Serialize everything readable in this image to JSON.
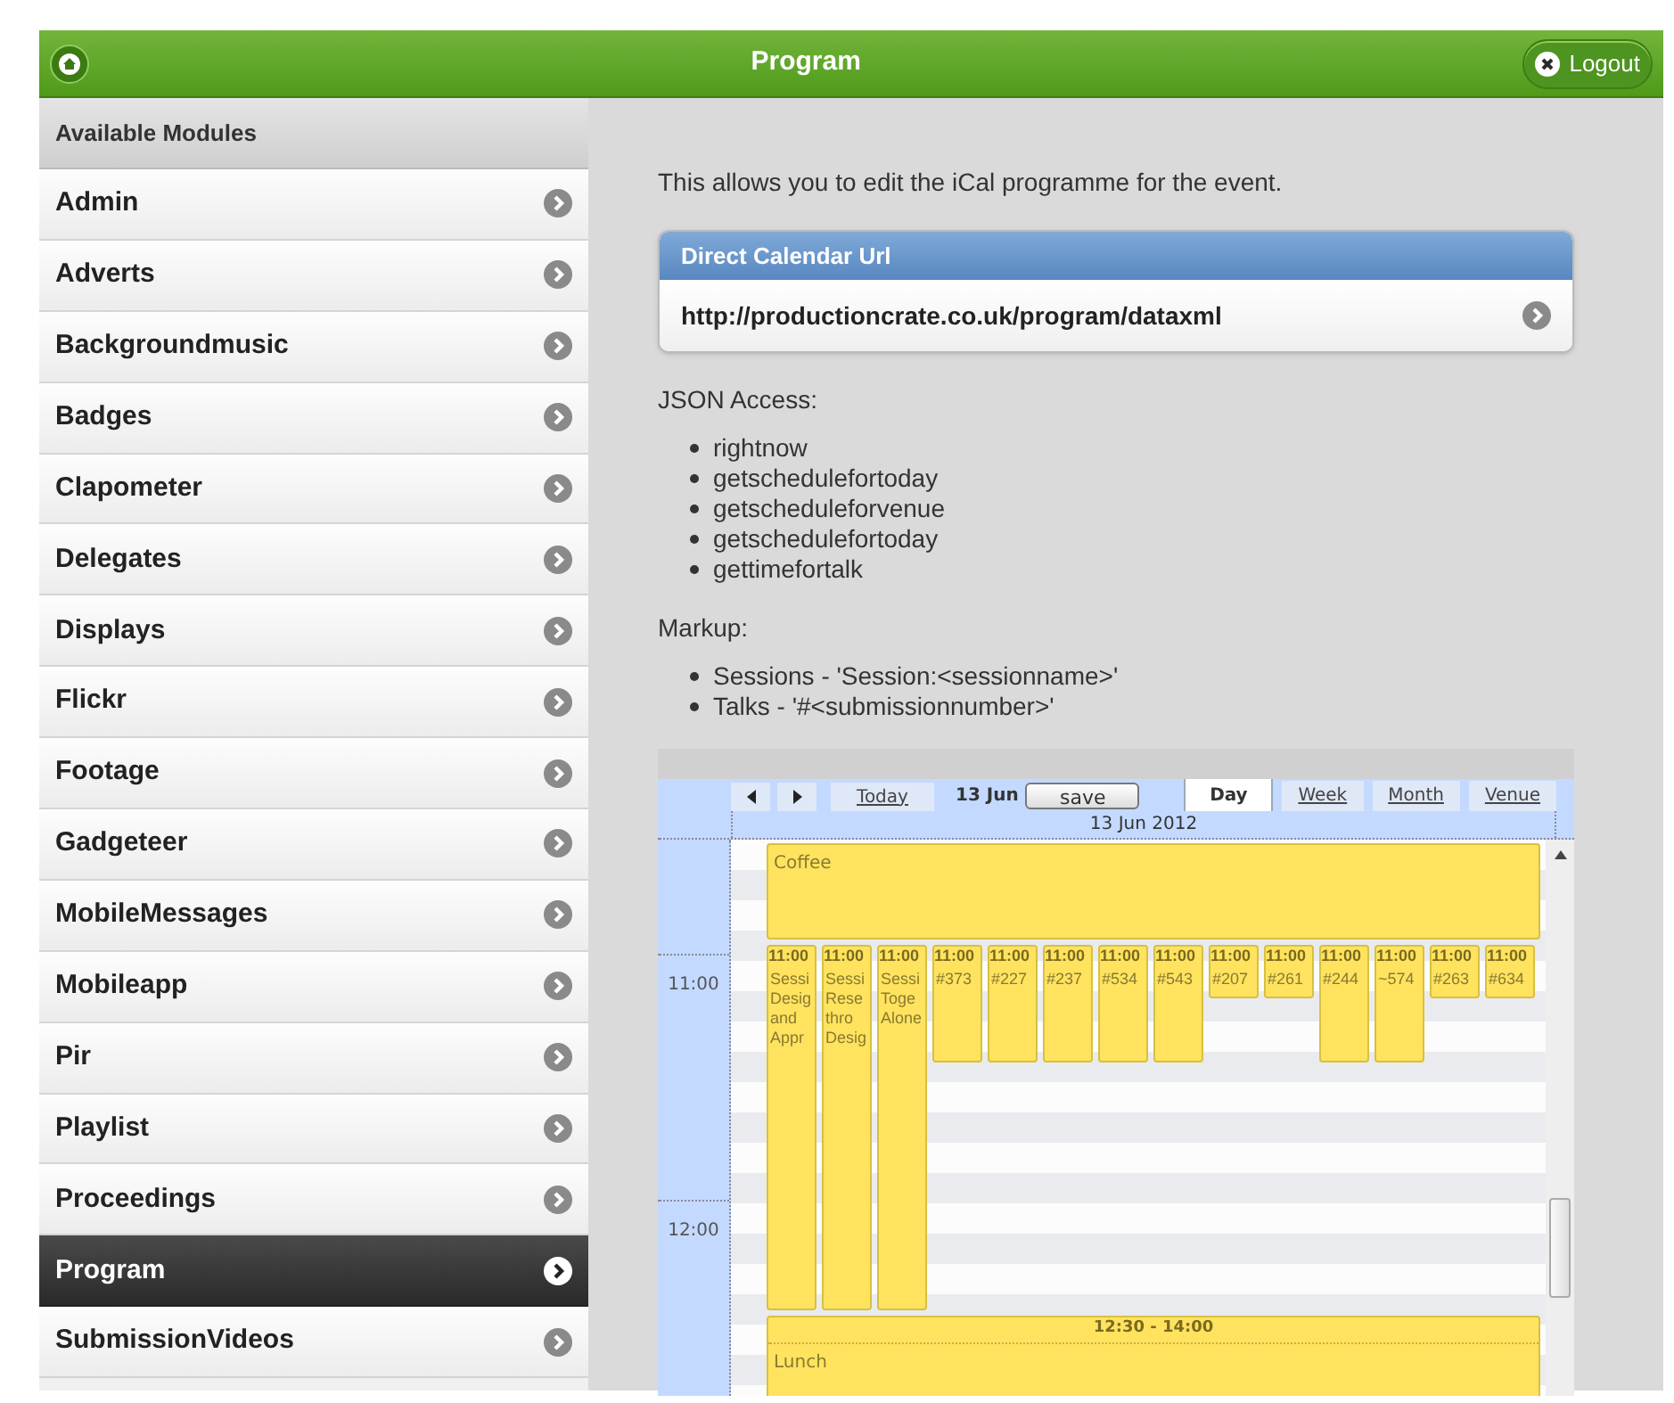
{
  "header": {
    "title": "Program",
    "logout": "Logout"
  },
  "sidebar": {
    "title": "Available Modules",
    "items": [
      {
        "label": "Admin",
        "selected": false
      },
      {
        "label": "Adverts",
        "selected": false
      },
      {
        "label": "Backgroundmusic",
        "selected": false
      },
      {
        "label": "Badges",
        "selected": false
      },
      {
        "label": "Clapometer",
        "selected": false
      },
      {
        "label": "Delegates",
        "selected": false
      },
      {
        "label": "Displays",
        "selected": false
      },
      {
        "label": "Flickr",
        "selected": false
      },
      {
        "label": "Footage",
        "selected": false
      },
      {
        "label": "Gadgeteer",
        "selected": false
      },
      {
        "label": "MobileMessages",
        "selected": false
      },
      {
        "label": "Mobileapp",
        "selected": false
      },
      {
        "label": "Pir",
        "selected": false
      },
      {
        "label": "Playlist",
        "selected": false
      },
      {
        "label": "Proceedings",
        "selected": false
      },
      {
        "label": "Program",
        "selected": true
      },
      {
        "label": "SubmissionVideos",
        "selected": false
      }
    ]
  },
  "intro": "This allows you to edit the iCal programme for the event.",
  "calendar_url": {
    "title": "Direct Calendar Url",
    "url": "http://productioncrate.co.uk/program/dataxml"
  },
  "json_access": {
    "title": "JSON Access:",
    "items": [
      "rightnow",
      "getschedulefortoday",
      "getscheduleforvenue",
      "getschedulefortoday",
      "gettimefortalk"
    ]
  },
  "markup": {
    "title": "Markup:",
    "items": [
      "Sessions - 'Session:<sessionname>'",
      "Talks - '#<submissionnumber>'"
    ]
  },
  "calendar": {
    "today": "Today",
    "date": "13 Jun",
    "save": "save",
    "date_header": "13 Jun 2012",
    "views": [
      {
        "label": "Day",
        "selected": true
      },
      {
        "label": "Week",
        "selected": false
      },
      {
        "label": "Month",
        "selected": false
      },
      {
        "label": "Venue",
        "selected": false
      }
    ],
    "hours": [
      "11:00",
      "12:00"
    ],
    "coffee": "Coffee",
    "events": [
      {
        "time": "11:00",
        "text": "Sessi Desig and Appr",
        "kind": "long"
      },
      {
        "time": "11:00",
        "text": "Sessi Rese thro Desig",
        "kind": "long"
      },
      {
        "time": "11:00",
        "text": "Sessi Toge Alone",
        "kind": "long"
      },
      {
        "time": "11:00",
        "text": "#373",
        "kind": "medium"
      },
      {
        "time": "11:00",
        "text": "#227",
        "kind": "medium"
      },
      {
        "time": "11:00",
        "text": "#237",
        "kind": "medium"
      },
      {
        "time": "11:00",
        "text": "#534",
        "kind": "medium"
      },
      {
        "time": "11:00",
        "text": "#543",
        "kind": "medium"
      },
      {
        "time": "11:00",
        "text": "#207",
        "kind": "short"
      },
      {
        "time": "11:00",
        "text": "#261",
        "kind": "short"
      },
      {
        "time": "11:00",
        "text": "#244",
        "kind": "medium"
      },
      {
        "time": "11:00",
        "text": "~574",
        "kind": "medium"
      },
      {
        "time": "11:00",
        "text": "#263",
        "kind": "short"
      },
      {
        "time": "11:00",
        "text": "#634",
        "kind": "short"
      }
    ],
    "lunch": {
      "time": "12:30 - 14:00",
      "text": "Lunch"
    }
  }
}
